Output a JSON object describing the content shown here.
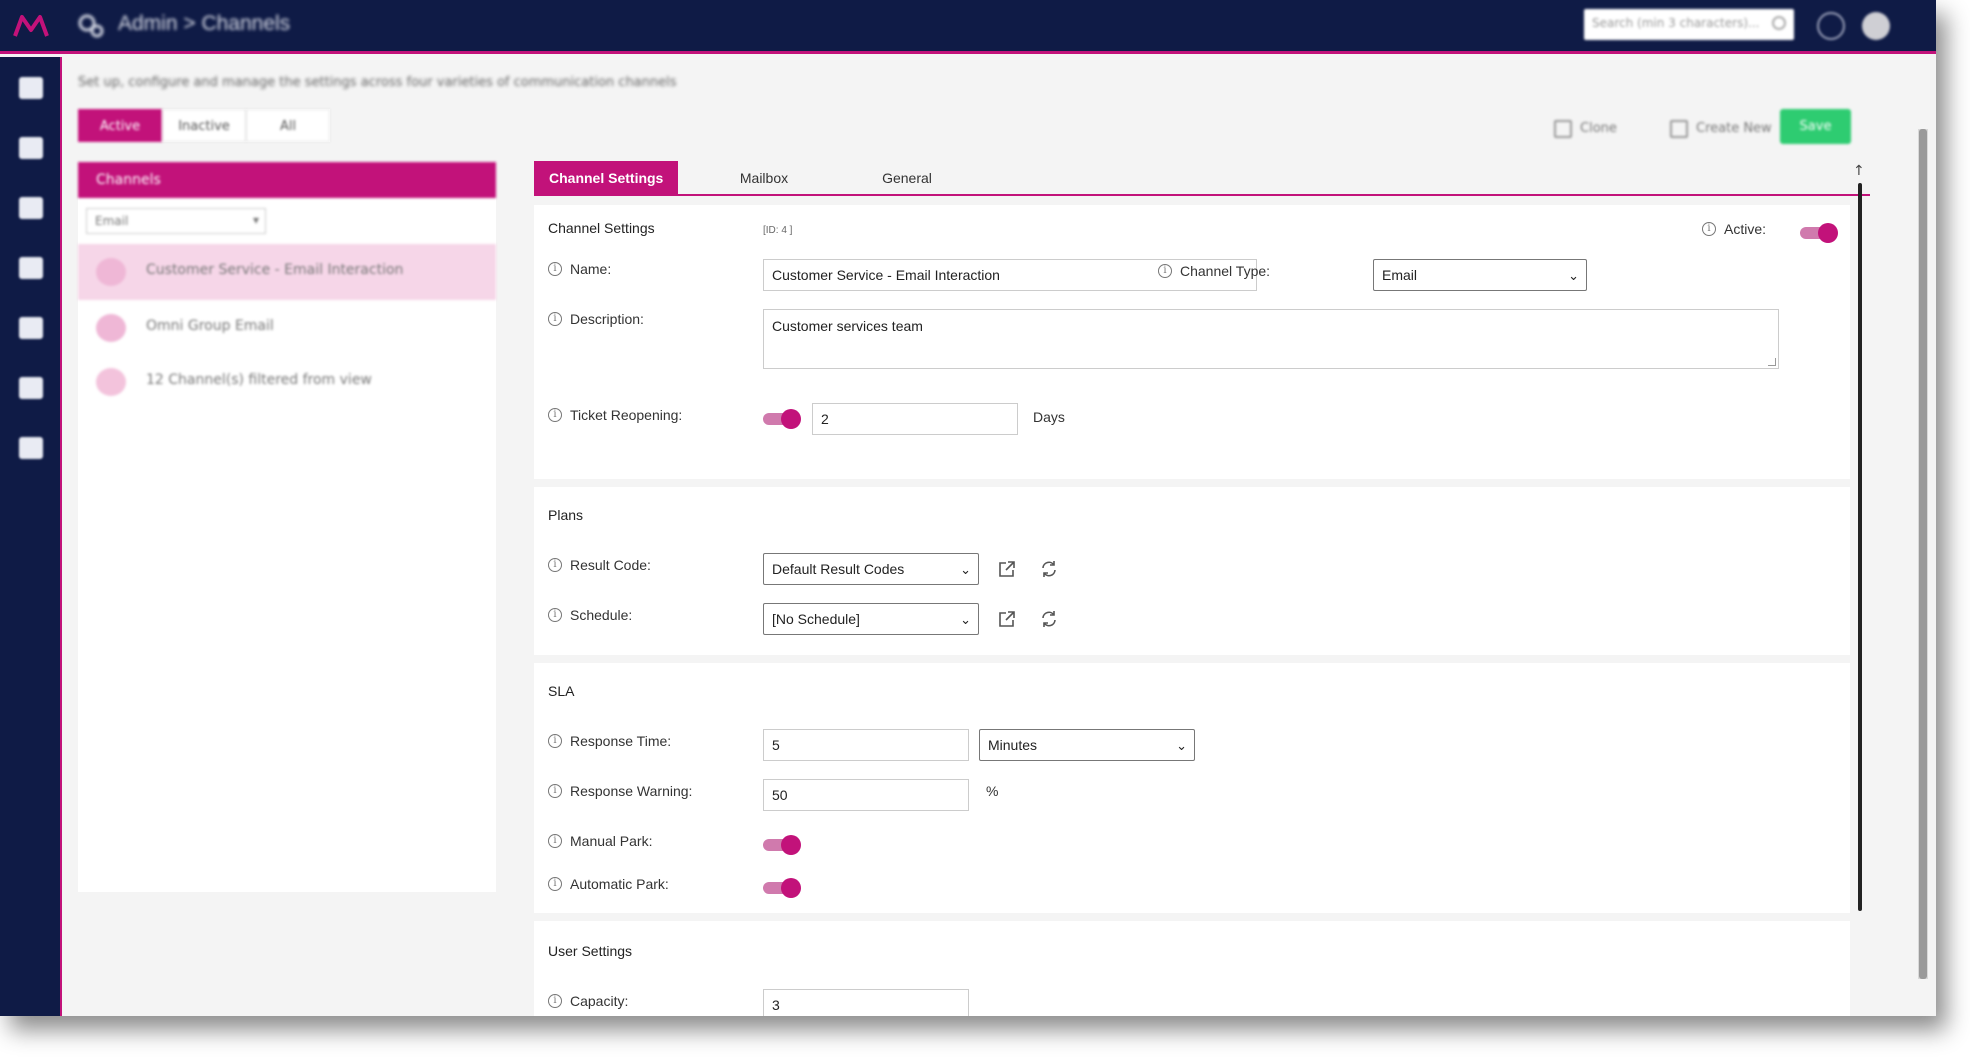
{
  "topbar": {
    "breadcrumb": "Admin > Channels",
    "search_placeholder": "Search (min 3 characters)..."
  },
  "sidebar": {
    "items": [
      "home-icon",
      "list-icon",
      "dashboard-icon",
      "database-icon",
      "building-icon",
      "document-icon",
      "settings-icon"
    ]
  },
  "page": {
    "subtitle": "Set up, configure and manage the settings across four varieties of communication channels",
    "filter_tabs": [
      "Active",
      "Inactive",
      "All"
    ],
    "actions": {
      "clone": "Clone",
      "create_new": "Create New",
      "save": "Save"
    }
  },
  "channels": {
    "header": "Channels",
    "filter_value": "Email",
    "items": [
      {
        "label": "Customer Service - Email Interaction",
        "selected": true
      },
      {
        "label": "Omni Group Email",
        "selected": false
      },
      {
        "label": "12 Channel(s) filtered from view",
        "selected": false
      }
    ]
  },
  "tabs": [
    "Channel Settings",
    "Mailbox",
    "General"
  ],
  "channel_settings": {
    "title": "Channel Settings",
    "id_label": "[ID: 4 ]",
    "active_label": "Active:",
    "active": true,
    "name_label": "Name:",
    "name_value": "Customer Service - Email Interaction",
    "channel_type_label": "Channel Type:",
    "channel_type_value": "Email",
    "description_label": "Description:",
    "description_value": "Customer services team",
    "ticket_reopening_label": "Ticket Reopening:",
    "ticket_reopening_enabled": true,
    "ticket_reopening_value": "2",
    "ticket_reopening_unit": "Days"
  },
  "plans": {
    "title": "Plans",
    "result_code_label": "Result Code:",
    "result_code_value": "Default Result Codes",
    "schedule_label": "Schedule:",
    "schedule_value": "[No Schedule]"
  },
  "sla": {
    "title": "SLA",
    "response_time_label": "Response Time:",
    "response_time_value": "5",
    "response_time_unit": "Minutes",
    "response_warning_label": "Response Warning:",
    "response_warning_value": "50",
    "response_warning_unit": "%",
    "manual_park_label": "Manual Park:",
    "manual_park": true,
    "automatic_park_label": "Automatic Park:",
    "automatic_park": true
  },
  "user_settings": {
    "title": "User Settings",
    "capacity_label": "Capacity:",
    "capacity_value": "3"
  },
  "colors": {
    "navy": "#0f1b46",
    "accent": "#c2127a",
    "save_green": "#2ecc71"
  }
}
